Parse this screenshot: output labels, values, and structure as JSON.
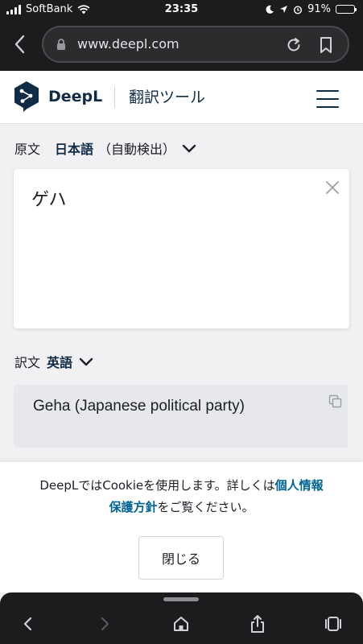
{
  "status": {
    "carrier": "SoftBank",
    "time": "23:35",
    "battery": "91%",
    "battery_level": 0.91
  },
  "browser": {
    "url": "www.deepl.com"
  },
  "header": {
    "brand": "DeepL",
    "tool_title": "翻訳ツール"
  },
  "source": {
    "label": "原文",
    "language": "日本語",
    "detect": "（自動検出）",
    "text": "ゲハ"
  },
  "target": {
    "label": "訳文",
    "language": "英語",
    "text": "Geha (Japanese political party)"
  },
  "cookie": {
    "msg_part1": "DeepLではCookieを使用します。詳しくは",
    "link_part1": "個人情報",
    "link_part2": "保護方針",
    "msg_part2": "をご覧ください。",
    "close_label": "閉じる"
  },
  "colors": {
    "accent": "#0f2b46",
    "link": "#006494",
    "chrome": "#1c1c1e"
  }
}
